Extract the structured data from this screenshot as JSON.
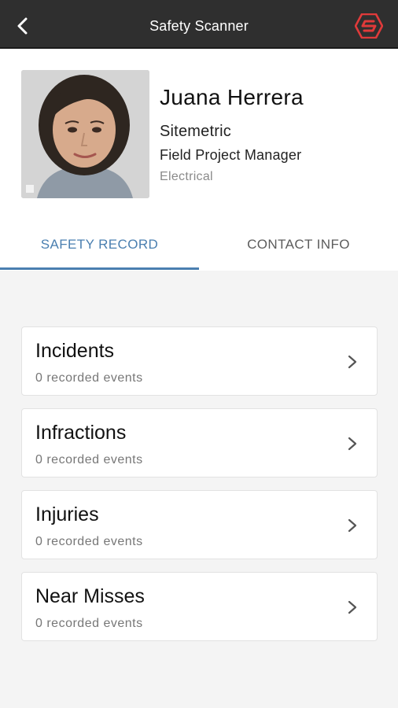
{
  "header": {
    "title": "Safety Scanner",
    "back_icon": "chevron-left-icon",
    "logo_icon": "hexagon-s-logo",
    "bg_color": "#2f2f2f",
    "logo_color": "#e03a3a"
  },
  "profile": {
    "name": "Juana Herrera",
    "company": "Sitemetric",
    "role": "Field Project Manager",
    "trade": "Electrical"
  },
  "tabs": [
    {
      "label": "SAFETY RECORD",
      "active": true
    },
    {
      "label": "CONTACT INFO",
      "active": false
    }
  ],
  "accent_color": "#4a7fb0",
  "records": [
    {
      "title": "Incidents",
      "subtitle": "0 recorded events"
    },
    {
      "title": "Infractions",
      "subtitle": "0 recorded events"
    },
    {
      "title": "Injuries",
      "subtitle": "0 recorded events"
    },
    {
      "title": "Near Misses",
      "subtitle": "0 recorded events"
    }
  ]
}
